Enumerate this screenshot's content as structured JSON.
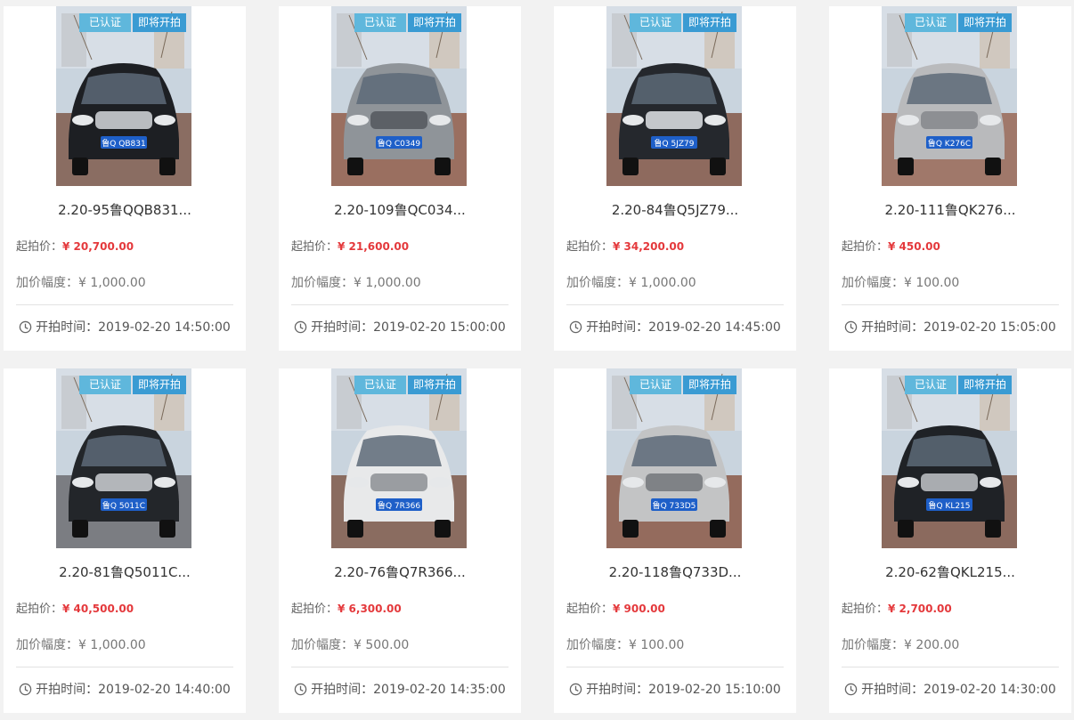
{
  "accent_colors": {
    "price": "#e4393c",
    "certified_badge": "#5fb7dc",
    "upcoming_badge": "#3a9bd3"
  },
  "labels": {
    "certified": "已认证",
    "upcoming": "即将开拍",
    "start_price": "起拍价：",
    "increment": "加价幅度：",
    "start_time": "开拍时间："
  },
  "cards": [
    {
      "title": "2.20-95鲁QQB831...",
      "price": "¥ 20,700.00",
      "increment": "¥ 1,000.00",
      "time": "2019-02-20 14:50:00",
      "plate": "鲁Q QB831",
      "car_color": "#1d1f23",
      "grille": "#b9bcc0",
      "bg": "#8a6d62"
    },
    {
      "title": "2.20-109鲁QC034...",
      "price": "¥ 21,600.00",
      "increment": "¥ 1,000.00",
      "time": "2019-02-20 15:00:00",
      "plate": "鲁Q C0349",
      "car_color": "#8f9499",
      "grille": "#5c6066",
      "bg": "#9a6f60"
    },
    {
      "title": "2.20-84鲁Q5JZ79...",
      "price": "¥ 34,200.00",
      "increment": "¥ 1,000.00",
      "time": "2019-02-20 14:45:00",
      "plate": "鲁Q 5JZ79",
      "car_color": "#25282d",
      "grille": "#c4c7cb",
      "bg": "#8e6a5e"
    },
    {
      "title": "2.20-111鲁QK276...",
      "price": "¥ 450.00",
      "increment": "¥ 100.00",
      "time": "2019-02-20 15:05:00",
      "plate": "鲁Q K276C",
      "car_color": "#b9babc",
      "grille": "#8d8f93",
      "bg": "#a0786a"
    },
    {
      "title": "2.20-81鲁Q5011C...",
      "price": "¥ 40,500.00",
      "increment": "¥ 1,000.00",
      "time": "2019-02-20 14:40:00",
      "plate": "鲁Q 5011C",
      "car_color": "#23262a",
      "grille": "#b3b6ba",
      "bg": "#7b7d82"
    },
    {
      "title": "2.20-76鲁Q7R366...",
      "price": "¥ 6,300.00",
      "increment": "¥ 500.00",
      "time": "2019-02-20 14:35:00",
      "plate": "鲁Q 7R366",
      "car_color": "#e8e9ea",
      "grille": "#9a9da1",
      "bg": "#8a6c60"
    },
    {
      "title": "2.20-118鲁Q733D...",
      "price": "¥ 900.00",
      "increment": "¥ 100.00",
      "time": "2019-02-20 15:10:00",
      "plate": "鲁Q 733D5",
      "car_color": "#c3c4c5",
      "grille": "#7f8286",
      "bg": "#946b5d"
    },
    {
      "title": "2.20-62鲁QKL215...",
      "price": "¥ 2,700.00",
      "increment": "¥ 200.00",
      "time": "2019-02-20 14:30:00",
      "plate": "鲁Q KL215",
      "car_color": "#1f2226",
      "grille": "#a9acb0",
      "bg": "#8b6a5e"
    }
  ]
}
